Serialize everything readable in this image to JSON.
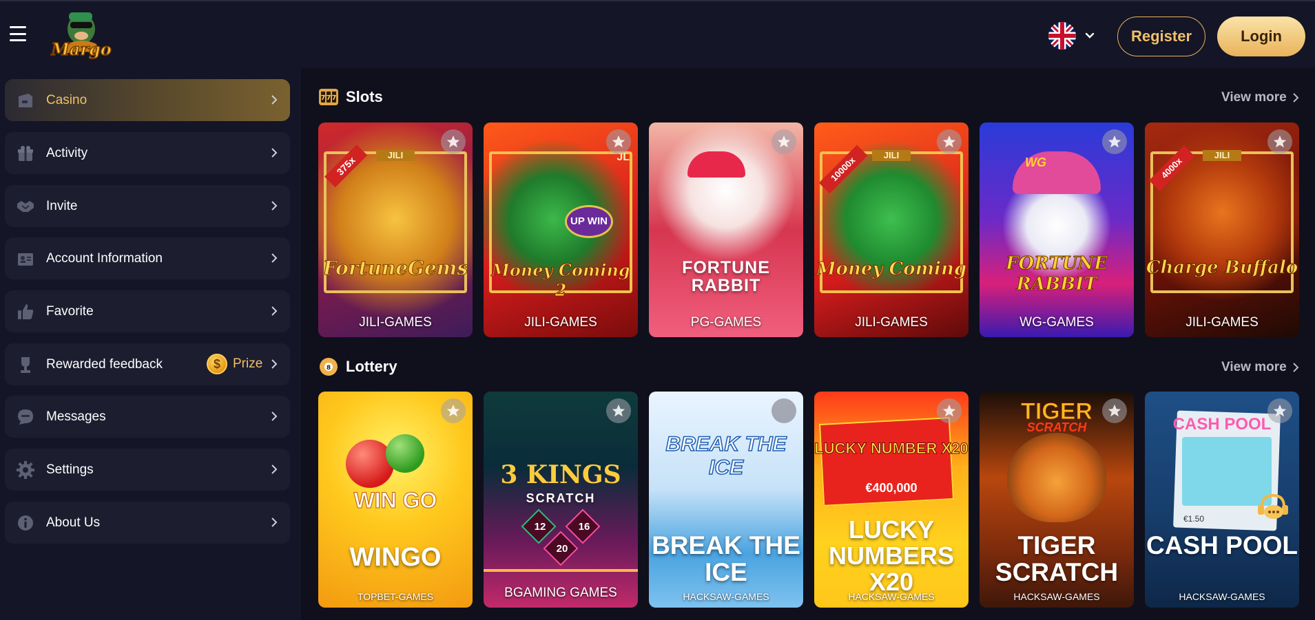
{
  "header": {
    "logo_text": "Margo",
    "register_label": "Register",
    "login_label": "Login",
    "language": "English (UK)"
  },
  "sidebar": {
    "items": [
      {
        "label": "Casino",
        "icon": "casino-icon",
        "active": true
      },
      {
        "label": "Activity",
        "icon": "gift-icon"
      },
      {
        "label": "Invite",
        "icon": "handshake-icon"
      },
      {
        "label": "Account Information",
        "icon": "id-card-icon"
      },
      {
        "label": "Favorite",
        "icon": "thumbs-up-icon"
      },
      {
        "label": "Rewarded feedback",
        "icon": "trophy-icon",
        "badge": "Prize"
      },
      {
        "label": "Messages",
        "icon": "chat-icon"
      },
      {
        "label": "Settings",
        "icon": "gear-icon"
      },
      {
        "label": "About Us",
        "icon": "info-icon"
      }
    ]
  },
  "sections": {
    "slots": {
      "title": "Slots",
      "view_more": "View more",
      "games": [
        {
          "art_text": "FortuneGems",
          "multiplier": "375x",
          "brand": "JILI",
          "provider": "JILI-GAMES"
        },
        {
          "art_text": "Money Coming 2",
          "brand": "JL",
          "badge": "UP WIN",
          "provider": "JILI-GAMES"
        },
        {
          "art_text": "FORTUNE RABBIT",
          "provider": "PG-GAMES"
        },
        {
          "art_text": "Money Coming",
          "multiplier": "10000x",
          "brand": "JILI",
          "provider": "JILI-GAMES"
        },
        {
          "art_text": "FORTUNE RABBIT",
          "brand": "WG",
          "provider": "WG-GAMES"
        },
        {
          "art_text": "Charge Buffalo",
          "multiplier": "4000x",
          "brand": "JILI",
          "provider": "JILI-GAMES"
        }
      ]
    },
    "lottery": {
      "title": "Lottery",
      "view_more": "View more",
      "games": [
        {
          "art_text": "WIN GO",
          "title": "WINGO",
          "provider": "TOPBET-GAMES"
        },
        {
          "art_text": "3 KINGS",
          "art_sub": "SCRATCH",
          "numbers": [
            "12",
            "16",
            "20"
          ],
          "provider": "BGAMING GAMES"
        },
        {
          "art_text": "BREAK THE ICE",
          "title": "BREAK THE ICE",
          "provider": "HACKSAW-GAMES"
        },
        {
          "art_text": "LUCKY NUMBER X20",
          "art_sub": "€400,000",
          "title": "LUCKY NUMBERS X20",
          "provider": "HACKSAW-GAMES"
        },
        {
          "art_text": "TIGER",
          "art_sub": "SCRATCH",
          "title": "TIGER SCRATCH",
          "provider": "HACKSAW-GAMES"
        },
        {
          "art_text": "CASH POOL",
          "art_sub": "€1.50",
          "title": "CASH POOL",
          "provider": "HACKSAW-GAMES"
        }
      ]
    }
  }
}
